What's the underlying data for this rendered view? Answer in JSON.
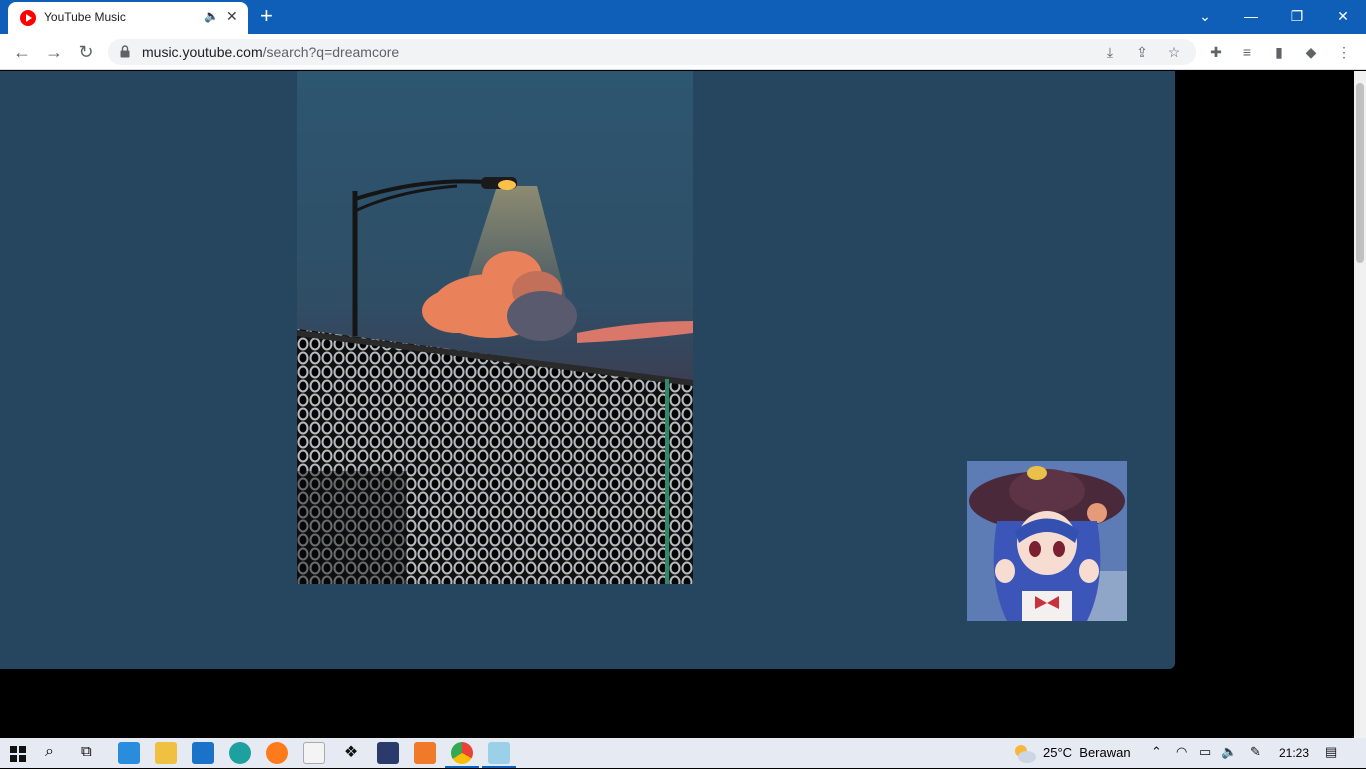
{
  "browser": {
    "tab": {
      "title": "YouTube Music"
    },
    "url": {
      "host": "music.youtube.com",
      "path": "/search?q=dreamcore"
    },
    "new_tab_glyph": "+",
    "window_controls": {
      "minimize": "—",
      "restore": "❐",
      "close": "✕",
      "tabsearch": "⌄"
    },
    "nav": {
      "back": "←",
      "forward": "→",
      "reload": "↻"
    }
  },
  "page": {
    "panel_color": "#26465f",
    "images": [
      {
        "name": "dreamcore-streetlamp-art"
      },
      {
        "name": "anime-avatar-thumbnail"
      }
    ]
  },
  "taskbar": {
    "weather": {
      "temp": "25°C",
      "condition": "Berawan"
    },
    "clock": "21:23",
    "apps": [
      "start-icon",
      "search-icon",
      "task-view-icon",
      "whiteboard-icon",
      "file-explorer-icon",
      "mail-icon",
      "edge-icon",
      "firefox-icon",
      "amazon-icon",
      "dropbox-icon",
      "stocks-icon",
      "xampp-icon",
      "chrome-icon",
      "notepad-icon"
    ]
  },
  "colors": {
    "tabstrip": "#0f5fb8",
    "accent": "#0a64c8",
    "youtube_red": "#ff0000"
  }
}
